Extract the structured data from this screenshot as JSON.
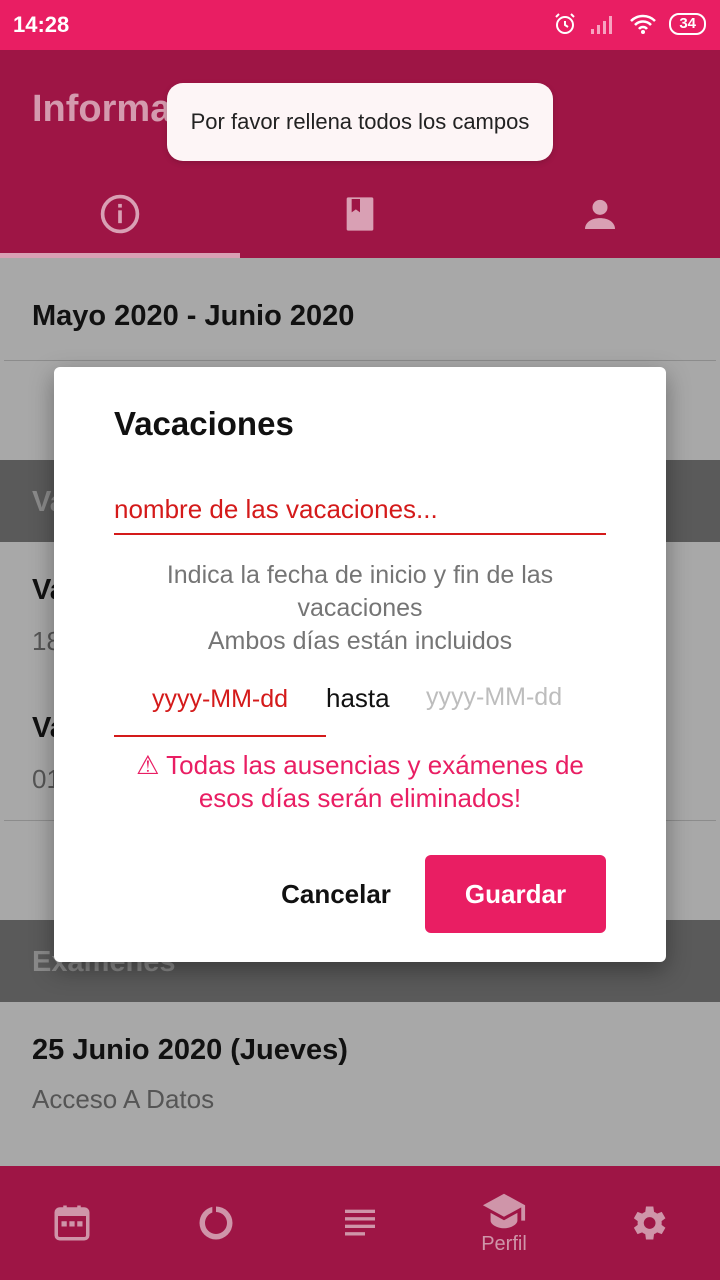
{
  "status_bar": {
    "time": "14:28",
    "battery": "34"
  },
  "app_bar": {
    "title": "Información"
  },
  "tabs": [
    {
      "icon": "info-icon",
      "active": true
    },
    {
      "icon": "book-icon",
      "active": false
    },
    {
      "icon": "person-icon",
      "active": false
    }
  ],
  "toast": {
    "message": "Por favor rellena todos los campos"
  },
  "content": {
    "period": "Mayo 2020 - Junio 2020",
    "vacations_section_partial": "Va",
    "vacation_items": [
      {
        "title_partial": "Va",
        "sub_partial": "18"
      },
      {
        "title_partial": "Va",
        "sub_partial": "01"
      }
    ],
    "exams_section": "Exámenes",
    "exam": {
      "date": "25 Junio 2020 (Jueves)",
      "subject": "Acceso A Datos"
    }
  },
  "dialog": {
    "title": "Vacaciones",
    "name_placeholder": "nombre de las vacaciones...",
    "info_line1": "Indica la fecha de inicio y fin de las vacaciones",
    "info_line2": "Ambos días están incluidos",
    "date_from": "yyyy-MM-dd",
    "date_separator": "hasta",
    "date_to": "yyyy-MM-dd",
    "warning": "⚠ Todas las ausencias y exámenes de esos días serán eliminados!",
    "cancel_label": "Cancelar",
    "save_label": "Guardar"
  },
  "bottom_nav": [
    {
      "icon": "calendar-icon",
      "label": ""
    },
    {
      "icon": "progress-icon",
      "label": ""
    },
    {
      "icon": "list-icon",
      "label": ""
    },
    {
      "icon": "school-icon",
      "label": "Perfil"
    },
    {
      "icon": "settings-icon",
      "label": ""
    }
  ],
  "colors": {
    "primary": "#e91e63",
    "primary_dark_dimmed": "#9e1545",
    "error": "#d41a1a"
  }
}
